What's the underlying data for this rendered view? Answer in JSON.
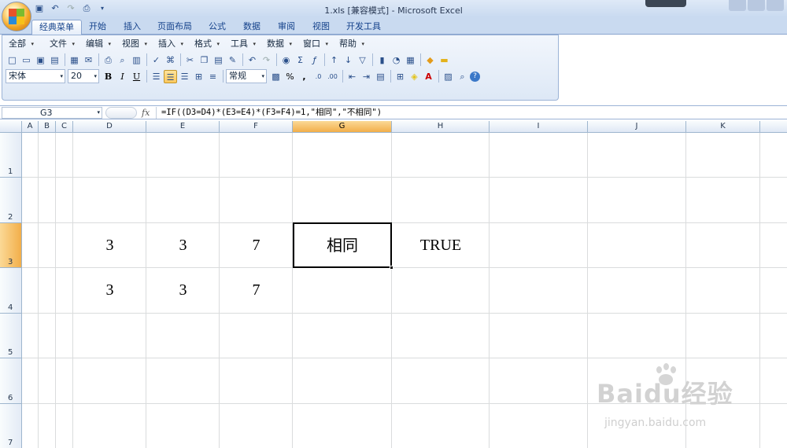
{
  "title": "1.xls  [兼容模式] - Microsoft Excel",
  "tabs": [
    "经典菜单",
    "开始",
    "插入",
    "页面布局",
    "公式",
    "数据",
    "审阅",
    "视图",
    "开发工具"
  ],
  "menu": [
    "全部",
    "文件",
    "编辑",
    "视图",
    "插入",
    "格式",
    "工具",
    "数据",
    "窗口",
    "帮助"
  ],
  "font_name": "宋体",
  "font_size": "20",
  "number_format": "常规",
  "name_box": "G3",
  "fx_label": "fx",
  "formula": "=IF((D3=D4)*(E3=E4)*(F3=F4)=1,\"相同\",\"不相同\")",
  "columns": [
    "A",
    "B",
    "C",
    "D",
    "E",
    "F",
    "G",
    "H",
    "I",
    "J",
    "K"
  ],
  "rows": [
    "1",
    "2",
    "3",
    "4",
    "5",
    "6",
    "7"
  ],
  "cells": {
    "D3": "3",
    "E3": "3",
    "F3": "7",
    "G3": "相同",
    "H3": "TRUE",
    "D4": "3",
    "E4": "3",
    "F4": "7"
  },
  "toolbar": {
    "bold": "B",
    "italic": "I",
    "underline": "U",
    "percent": "%",
    "comma": ","
  },
  "watermark": {
    "main": "Baidu经验",
    "sub": "jingyan.baidu.com"
  },
  "colors": {
    "selected_header": "#f2ae4a",
    "ribbon": "#dde8f6"
  }
}
